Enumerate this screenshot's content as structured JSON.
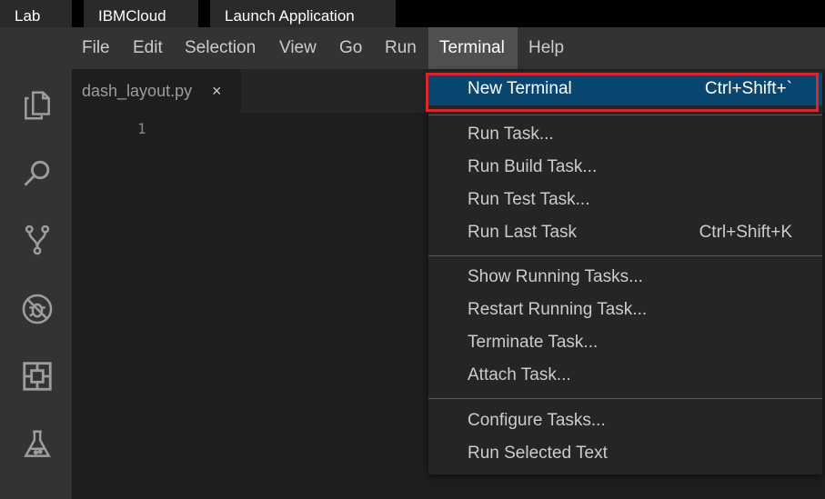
{
  "browser_tabs": [
    "Lab",
    "IBMCloud",
    "Launch Application"
  ],
  "menubar": {
    "items": [
      "File",
      "Edit",
      "Selection",
      "View",
      "Go",
      "Run",
      "Terminal",
      "Help"
    ],
    "active": "Terminal"
  },
  "activity_bar": {
    "icons": [
      "explorer-icon",
      "search-icon",
      "source-control-icon",
      "debug-icon",
      "extensions-icon",
      "lab-flask-icon"
    ]
  },
  "editor": {
    "tab_label": "dash_layout.py",
    "tab_close": "×",
    "line_numbers": [
      "1"
    ]
  },
  "terminal_menu": {
    "groups": [
      [
        {
          "label": "New Terminal",
          "shortcut": "Ctrl+Shift+`",
          "selected": true
        }
      ],
      [
        {
          "label": "Run Task...",
          "shortcut": ""
        },
        {
          "label": "Run Build Task...",
          "shortcut": ""
        },
        {
          "label": "Run Test Task...",
          "shortcut": ""
        },
        {
          "label": "Run Last Task",
          "shortcut": "Ctrl+Shift+K"
        }
      ],
      [
        {
          "label": "Show Running Tasks...",
          "shortcut": ""
        },
        {
          "label": "Restart Running Task...",
          "shortcut": ""
        },
        {
          "label": "Terminate Task...",
          "shortcut": ""
        },
        {
          "label": "Attach Task...",
          "shortcut": ""
        }
      ],
      [
        {
          "label": "Configure Tasks...",
          "shortcut": ""
        },
        {
          "label": "Run Selected Text",
          "shortcut": ""
        }
      ]
    ]
  },
  "colors": {
    "selection": "#094771",
    "highlight_border": "#d9262f"
  }
}
